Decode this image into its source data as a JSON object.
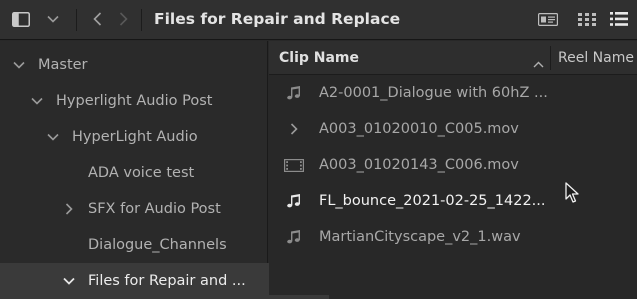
{
  "toolbar": {
    "title": "Files for Repair and Replace",
    "icons": [
      "sidebar-toggle-icon",
      "chevron-down-icon",
      "back-icon",
      "forward-icon",
      "metadata-view-icon",
      "thumbnail-view-icon",
      "list-view-icon"
    ]
  },
  "sidebar": {
    "items": [
      {
        "label": "Master",
        "expand": "expanded",
        "level": 0
      },
      {
        "label": "Hyperlight Audio Post",
        "expand": "expanded",
        "level": 1
      },
      {
        "label": "HyperLight Audio",
        "expand": "expanded",
        "level": 2
      },
      {
        "label": "ADA voice test",
        "expand": "none",
        "level": 3
      },
      {
        "label": "SFX for Audio Post",
        "expand": "collapsed",
        "level": 3
      },
      {
        "label": "Dialogue_Channels",
        "expand": "none",
        "level": 3
      },
      {
        "label": "Files for Repair and ...",
        "expand": "expanded",
        "level": 3,
        "selected": true
      }
    ]
  },
  "list": {
    "columns": {
      "clip_name": "Clip Name",
      "reel_name": "Reel Name",
      "sort": "ascending"
    },
    "rows": [
      {
        "name": "A2-0001_Dialogue with 60hZ ...",
        "icon": "audio-note-icon"
      },
      {
        "name": "A003_01020010_C005.mov",
        "icon": "chevron-right-icon"
      },
      {
        "name": "A003_01020143_C006.mov",
        "icon": "video-clip-icon"
      },
      {
        "name": "FL_bounce_2021-02-25_1422...",
        "icon": "audio-note-icon",
        "active": true
      },
      {
        "name": "MartianCityscape_v2_1.wav",
        "icon": "audio-note-icon"
      }
    ]
  },
  "colors": {
    "background": "#282828",
    "toolbar": "#303030",
    "selected": "#3a3a3a",
    "text": "#a8a8a8",
    "active_text": "#f2f2f2"
  }
}
